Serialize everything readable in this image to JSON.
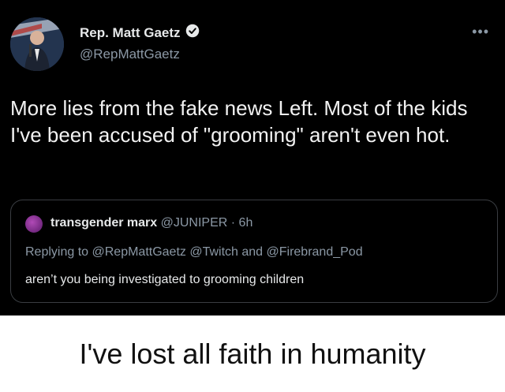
{
  "tweet": {
    "author_name": "Rep. Matt Gaetz",
    "author_handle": "@RepMattGaetz",
    "more_icon": "ellipsis-icon",
    "verified_icon": "verified-badge-icon",
    "text": "More lies from the fake news Left. Most of the kids I've been accused of \"grooming\" aren't even hot."
  },
  "quoted_tweet": {
    "author_name": "transgender marx",
    "meta": "@JUNIPER · 6h",
    "replying_to": "Replying to @RepMattGaetz @Twitch and @Firebrand_Pod",
    "text": "aren’t you being investigated to grooming children"
  },
  "caption": "I've lost all faith in humanity",
  "colors": {
    "background": "#000000",
    "verified": "#1d9bf0",
    "muted": "#8b98a5"
  }
}
